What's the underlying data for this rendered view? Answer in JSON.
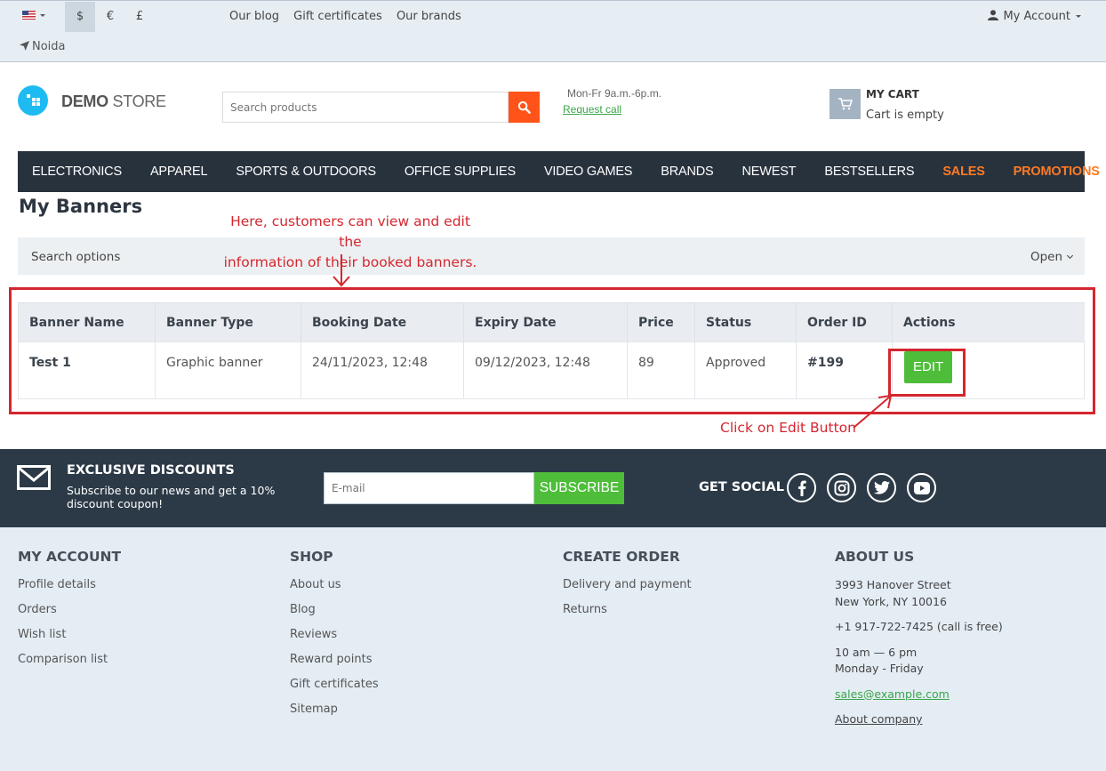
{
  "topbar": {
    "currencies": [
      "$",
      "€",
      "£"
    ],
    "active_currency": "$",
    "links": [
      "Our blog",
      "Gift certificates",
      "Our brands"
    ],
    "location": "Noida",
    "account_label": "My Account"
  },
  "header": {
    "logo_bold": "DEMO",
    "logo_light": "STORE",
    "search_placeholder": "Search products",
    "hours": "Mon-Fr 9a.m.-6p.m.",
    "request_call": "Request call",
    "cart_title": "MY CART",
    "cart_status": "Cart is empty"
  },
  "nav": {
    "items": [
      "ELECTRONICS",
      "APPAREL",
      "SPORTS & OUTDOORS",
      "OFFICE SUPPLIES",
      "VIDEO GAMES",
      "BRANDS",
      "NEWEST",
      "BESTSELLERS"
    ],
    "highlight_items": [
      "SALES",
      "PROMOTIONS"
    ]
  },
  "page": {
    "title": "My Banners",
    "search_options_label": "Search options",
    "search_options_toggle": "Open"
  },
  "table": {
    "headers": [
      "Banner Name",
      "Banner Type",
      "Booking Date",
      "Expiry Date",
      "Price",
      "Status",
      "Order ID",
      "Actions"
    ],
    "rows": [
      {
        "name": "Test 1",
        "type": "Graphic banner",
        "booking_date": "24/11/2023, 12:48",
        "expiry_date": "09/12/2023, 12:48",
        "price": "89",
        "status": "Approved",
        "order_id": "#199",
        "action_label": "EDIT"
      }
    ]
  },
  "annotations": {
    "top_note_line1": "Here, customers can view and edit the",
    "top_note_line2": "information of their booked banners.",
    "edit_note": "Click on Edit Button",
    "color": "#d5262f"
  },
  "newsletter": {
    "title": "EXCLUSIVE DISCOUNTS",
    "subtitle_line1": "Subscribe to our news and get a 10%",
    "subtitle_line2": "discount coupon!",
    "email_placeholder": "E-mail",
    "subscribe_label": "SUBSCRIBE",
    "social_title": "GET SOCIAL"
  },
  "footer": {
    "my_account": {
      "title": "MY ACCOUNT",
      "links": [
        "Profile details",
        "Orders",
        "Wish list",
        "Comparison list"
      ]
    },
    "shop": {
      "title": "SHOP",
      "links": [
        "About us",
        "Blog",
        "Reviews",
        "Reward points",
        "Gift certificates",
        "Sitemap"
      ]
    },
    "create_order": {
      "title": "CREATE ORDER",
      "links": [
        "Delivery and payment",
        "Returns"
      ]
    },
    "about_us": {
      "title": "ABOUT US",
      "address_line1": "3993 Hanover Street",
      "address_line2": "New York, NY 10016",
      "phone": "+1 917-722-7425 (call is free)",
      "hours_line1": "10 am — 6 pm",
      "hours_line2": "Monday - Friday",
      "email": "sales@example.com",
      "about_company": "About company"
    }
  },
  "colors": {
    "accent_orange": "#ff5319",
    "accent_green": "#4ebd3a",
    "nav_bg": "#28323d",
    "logo_blue": "#1dbbf2"
  }
}
